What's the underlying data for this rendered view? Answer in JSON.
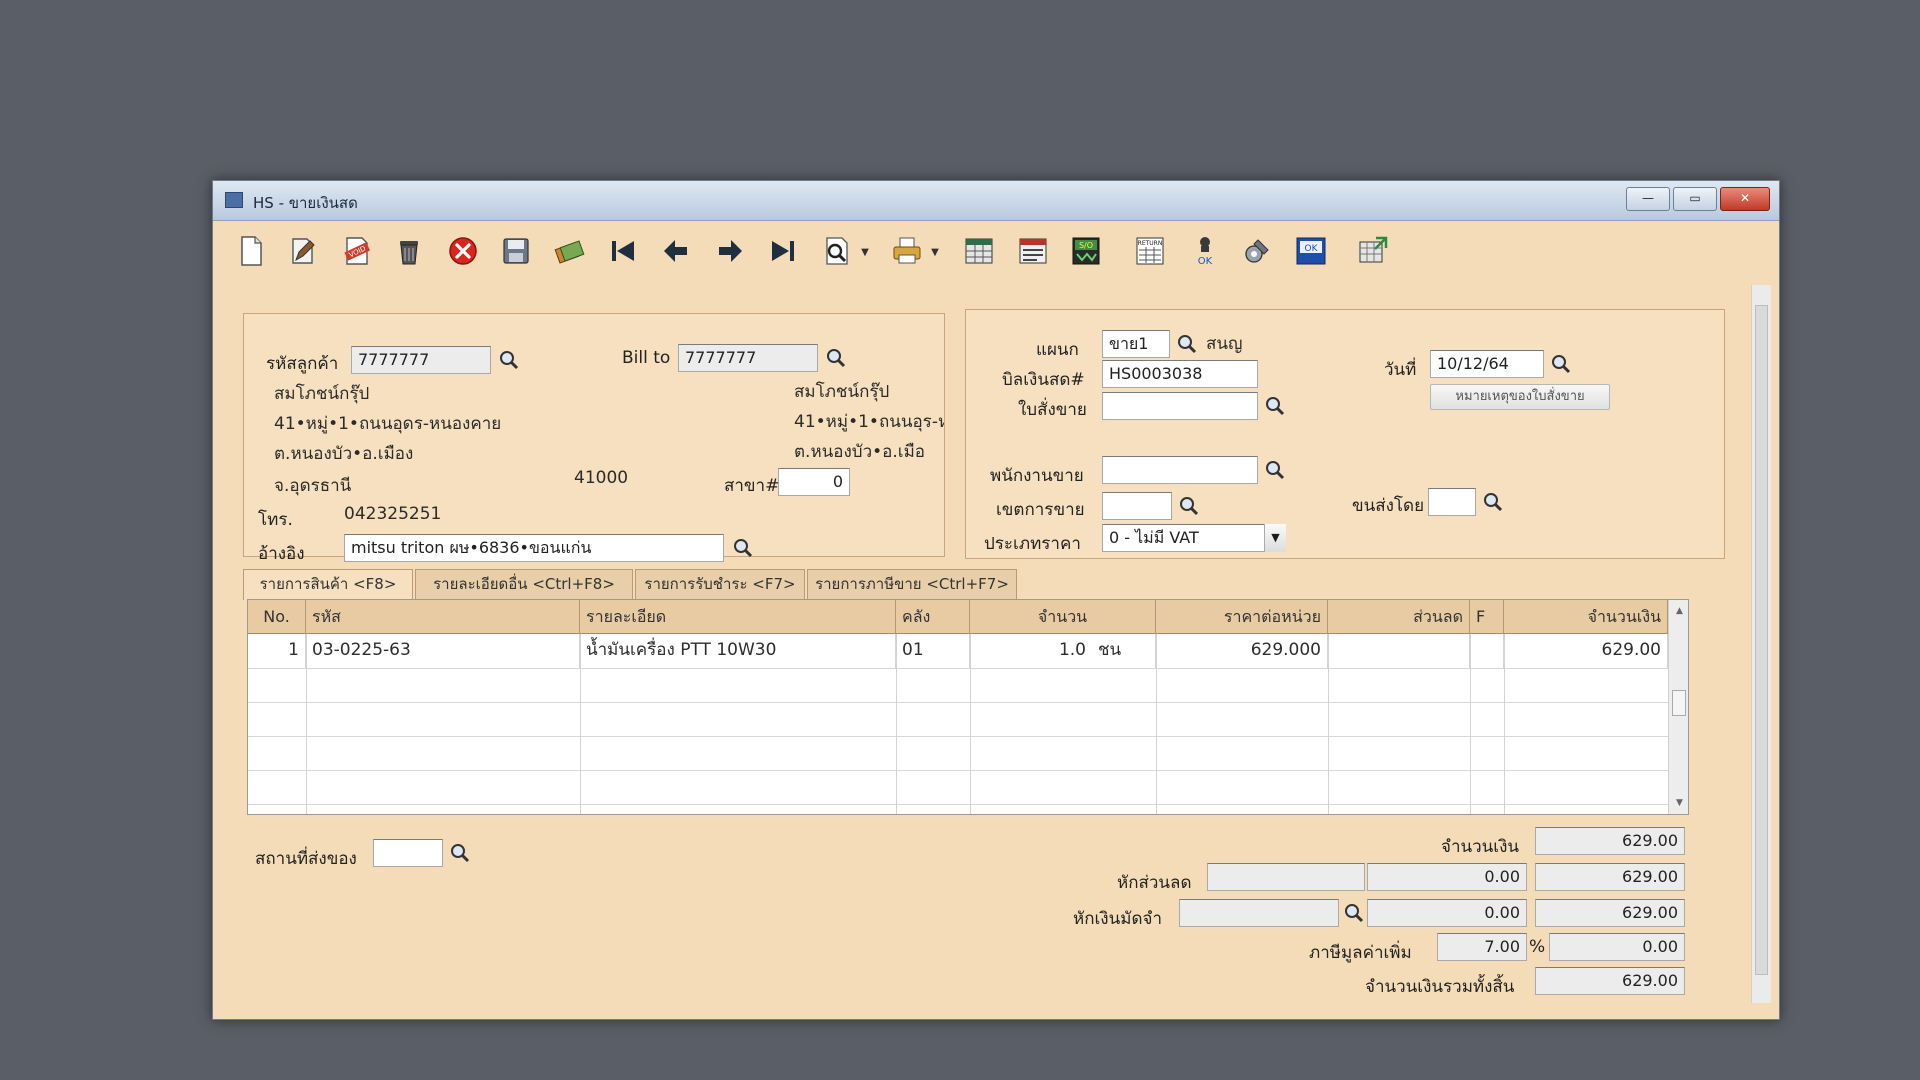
{
  "window": {
    "title": "HS - ขายเงินสด",
    "controls": {
      "minimize": "—",
      "maximize": "▭",
      "close": "✕"
    }
  },
  "toolbar": {
    "buttons": [
      {
        "name": "new-icon"
      },
      {
        "name": "edit-icon"
      },
      {
        "name": "void-icon"
      },
      {
        "name": "delete-icon"
      },
      {
        "name": "cancel-icon"
      },
      {
        "name": "save-icon"
      },
      {
        "name": "copy-doc-icon"
      },
      {
        "name": "first-record-icon"
      },
      {
        "name": "prev-record-icon"
      },
      {
        "name": "next-record-icon"
      },
      {
        "name": "last-record-icon"
      },
      {
        "name": "search-doc-icon"
      },
      {
        "name": "print-icon"
      },
      {
        "name": "table-view-icon"
      },
      {
        "name": "list-view-icon"
      },
      {
        "name": "so-icon"
      },
      {
        "name": "return-icon"
      },
      {
        "name": "approve-icon"
      },
      {
        "name": "tools-icon"
      },
      {
        "name": "ok-icon"
      },
      {
        "name": "export-icon"
      }
    ],
    "labels": {
      "so": "S/O",
      "ok": "OK",
      "return": "RETURN",
      "approve": "OK"
    }
  },
  "customer": {
    "code_label": "รหัสลูกค้า",
    "code_value": "7777777",
    "bill_to_label": "Bill to",
    "bill_to_value": "7777777",
    "name": "สมโภชน์กรุ๊ป",
    "address1": "41•หมู่•1•ถนนอุดร-หนองคาย",
    "address2": "ต.หนองบัว•อ.เมือง",
    "province": "จ.อุดรธานี",
    "postcode": "41000",
    "branch_label": "สาขา#",
    "branch_value": "0",
    "phone_label": "โทร.",
    "phone_value": "042325251",
    "ref_label": "อ้างอิง",
    "ref_value": "mitsu triton ผษ•6836•ขอนแก่น",
    "billto_name": "สมโภชน์กรุ๊ป",
    "billto_address1": "41•หมู่•1•ถนนอุร-ห",
    "billto_address2": "ต.หนองบัว•อ.เมือ"
  },
  "doc": {
    "dept_label": "แผนก",
    "dept_value": "ขาย1",
    "dept_name": "สนญ",
    "bill_no_label": "บิลเงินสด#",
    "bill_no_value": "HS0003038",
    "date_label": "วันที่",
    "date_value": "10/12/64",
    "so_label": "ใบสั่งขาย",
    "so_value": "",
    "so_note_button": "หมายเหตุของใบสั่งขาย",
    "salesman_label": "พนักงานขาย",
    "salesman_value": "",
    "area_label": "เขตการขาย",
    "area_value": "",
    "ship_by_label": "ขนส่งโดย",
    "ship_by_value": "",
    "price_type_label": "ประเภทราคา",
    "price_type_value": "0 - ไม่มี VAT"
  },
  "tabs": [
    {
      "label": "รายการสินค้า <F8>",
      "active": true
    },
    {
      "label": "รายละเอียดอื่น <Ctrl+F8>",
      "active": false
    },
    {
      "label": "รายการรับชำระ <F7>",
      "active": false
    },
    {
      "label": "รายการภาษีขาย <Ctrl+F7>",
      "active": false
    }
  ],
  "grid": {
    "headers": {
      "no": "No.",
      "code": "รหัส",
      "desc": "รายละเอียด",
      "wh": "คลัง",
      "qty": "จำนวน",
      "price": "ราคาต่อหน่วย",
      "disc": "ส่วนลด",
      "f": "F",
      "amount": "จำนวนเงิน"
    },
    "rows": [
      {
        "no": "1",
        "code": "03-0225-63",
        "desc": "น้ำมันเครื่อง PTT 10W30",
        "wh": "01",
        "qty": "1.0",
        "unit": "ชน",
        "price": "629.000",
        "disc": "",
        "f": "",
        "amount": "629.00"
      }
    ]
  },
  "totals": {
    "ship_place_label": "สถานที่ส่งของ",
    "ship_place_value": "",
    "amount_label": "จำนวนเงิน",
    "amount_value": "629.00",
    "discount_label": "หักส่วนลด",
    "discount_code": "",
    "discount_value": "0.00",
    "after_discount_value": "629.00",
    "deposit_label": "หักเงินมัดจำ",
    "deposit_code": "",
    "deposit_value": "0.00",
    "after_deposit_value": "629.00",
    "vat_label": "ภาษีมูลค่าเพิ่ม",
    "vat_rate": "7.00",
    "vat_pct_sign": "%",
    "vat_value": "0.00",
    "grand_total_label": "จำนวนเงินรวมทั้งสิ้น",
    "grand_total_value": "629.00"
  },
  "colors": {
    "form_bg": "#f4dcb8",
    "header_bg": "#e8cba3",
    "close_red": "#c03a26"
  }
}
